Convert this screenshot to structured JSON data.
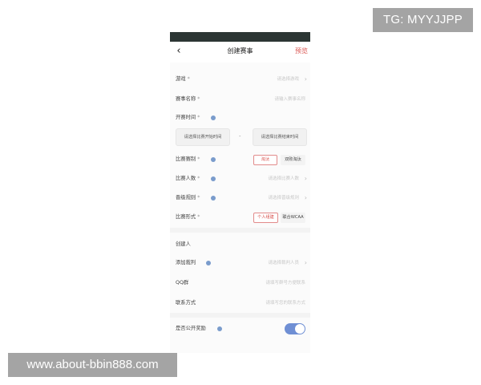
{
  "watermarks": {
    "tg": "TG: MYYJJPP",
    "url": "www.about-bbin888.com"
  },
  "nav": {
    "back_glyph": "‹",
    "title": "创建赛事",
    "preview": "预览"
  },
  "form": {
    "game": {
      "label": "游戏",
      "required": "*",
      "placeholder": "请选择游戏"
    },
    "name": {
      "label": "赛事名称",
      "required": "*",
      "placeholder": "请输入赛事名称"
    },
    "start_time": {
      "label": "开赛时间",
      "required": "*",
      "start_placeholder": "请选择比赛开始时间",
      "dash": "-",
      "end_placeholder": "请选择比赛结束时间"
    },
    "format": {
      "label": "比赛赛制",
      "required": "*",
      "options": [
        "淘汰",
        "双败淘汰"
      ],
      "selected": "淘汰"
    },
    "players": {
      "label": "比赛人数",
      "required": "*",
      "placeholder": "请选择比赛人数"
    },
    "advance": {
      "label": "晋级规则",
      "required": "*",
      "placeholder": "请选择晋级规则"
    },
    "mode": {
      "label": "比赛形式",
      "required": "*",
      "options": [
        "个人组建",
        "联合WCAA"
      ],
      "selected": "个人组建"
    },
    "creator": {
      "label": "创建人"
    },
    "referee": {
      "label": "添加裁判",
      "placeholder": "请选择裁判人员"
    },
    "qq": {
      "label": "QQ群",
      "placeholder": "请填写群号方便联系"
    },
    "contact": {
      "label": "联系方式",
      "placeholder": "请填写您的联系方式"
    },
    "public_reward": {
      "label": "是否公开奖励",
      "enabled": true
    }
  },
  "colors": {
    "accent": "#d9534f",
    "toggle_on": "#6f8fd4",
    "info_dot": "#7a9ccc",
    "status_bar": "#2c3634"
  },
  "icons": {
    "back": "chevron-left-icon",
    "row_arrow": "chevron-right-icon",
    "info": "info-icon"
  }
}
